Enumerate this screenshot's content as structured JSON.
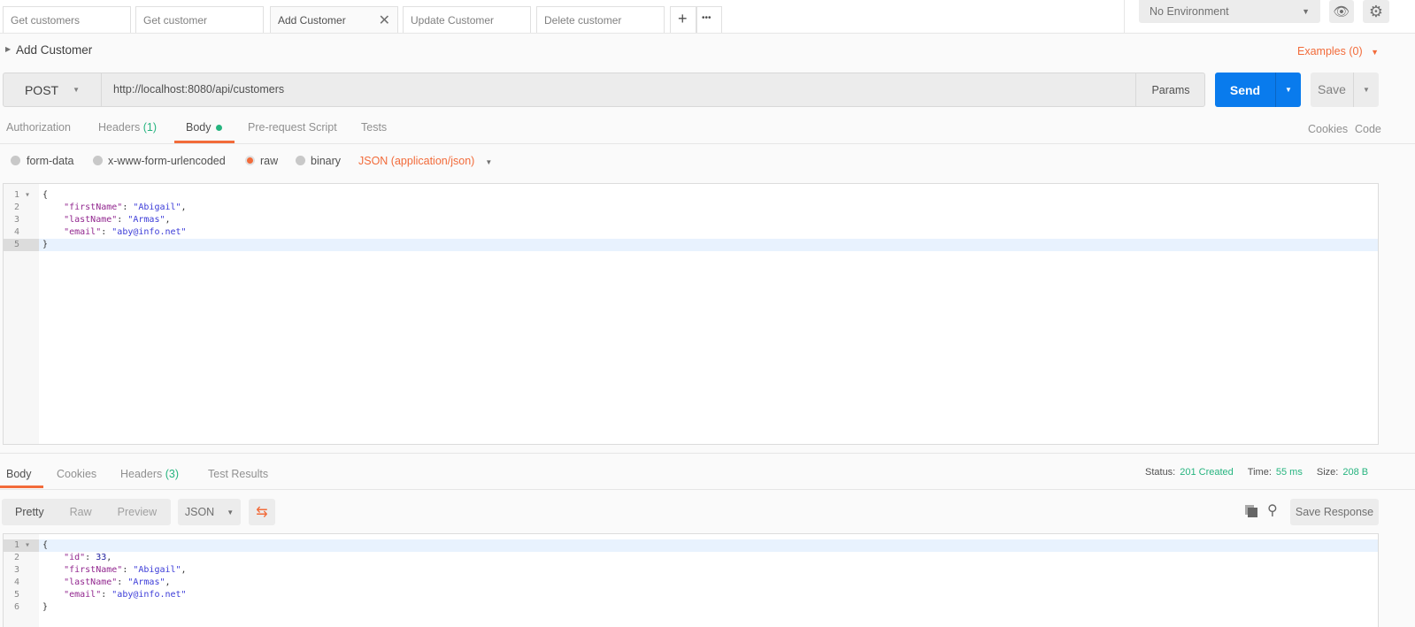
{
  "tabs": [
    {
      "label": "Get customers"
    },
    {
      "label": "Get customer"
    },
    {
      "label": "Add Customer",
      "active": true
    },
    {
      "label": "Update Customer"
    },
    {
      "label": "Delete customer"
    }
  ],
  "tab_add": "+",
  "tab_more": "•••",
  "environment": {
    "selected": "No Environment"
  },
  "request": {
    "title": "Add Customer",
    "examples": "Examples (0)",
    "method": "POST",
    "url": "http://localhost:8080/api/customers",
    "params": "Params",
    "send": "Send",
    "save": "Save"
  },
  "req_tabs": {
    "authorization": "Authorization",
    "headers": "Headers",
    "headers_count": "(1)",
    "body": "Body",
    "prerequest": "Pre-request Script",
    "tests": "Tests",
    "cookies": "Cookies",
    "code": "Code"
  },
  "body_options": {
    "form_data": "form-data",
    "urlencoded": "x-www-form-urlencoded",
    "raw": "raw",
    "binary": "binary",
    "content_type": "JSON (application/json)"
  },
  "request_body": [
    [
      {
        "t": "{",
        "c": "p"
      }
    ],
    [
      {
        "t": "    \"firstName\"",
        "c": "k"
      },
      {
        "t": ": ",
        "c": "p"
      },
      {
        "t": "\"Abigail\"",
        "c": "s"
      },
      {
        "t": ",",
        "c": "p"
      }
    ],
    [
      {
        "t": "    \"lastName\"",
        "c": "k"
      },
      {
        "t": ": ",
        "c": "p"
      },
      {
        "t": "\"Armas\"",
        "c": "s"
      },
      {
        "t": ",",
        "c": "p"
      }
    ],
    [
      {
        "t": "    \"email\"",
        "c": "k"
      },
      {
        "t": ": ",
        "c": "p"
      },
      {
        "t": "\"aby@info.net\"",
        "c": "s"
      }
    ],
    [
      {
        "t": "}",
        "c": "p"
      }
    ]
  ],
  "response": {
    "tabs": {
      "body": "Body",
      "cookies": "Cookies",
      "headers": "Headers",
      "headers_count": "(3)",
      "test_results": "Test Results"
    },
    "status_label": "Status:",
    "status": "201 Created",
    "time_label": "Time:",
    "time": "55 ms",
    "size_label": "Size:",
    "size": "208 B",
    "view": {
      "pretty": "Pretty",
      "raw": "Raw",
      "preview": "Preview",
      "format": "JSON"
    },
    "save_response": "Save Response",
    "body": [
      [
        {
          "t": "{",
          "c": "p"
        }
      ],
      [
        {
          "t": "    \"id\"",
          "c": "k"
        },
        {
          "t": ": ",
          "c": "p"
        },
        {
          "t": "33",
          "c": "n"
        },
        {
          "t": ",",
          "c": "p"
        }
      ],
      [
        {
          "t": "    \"firstName\"",
          "c": "k"
        },
        {
          "t": ": ",
          "c": "p"
        },
        {
          "t": "\"Abigail\"",
          "c": "s"
        },
        {
          "t": ",",
          "c": "p"
        }
      ],
      [
        {
          "t": "    \"lastName\"",
          "c": "k"
        },
        {
          "t": ": ",
          "c": "p"
        },
        {
          "t": "\"Armas\"",
          "c": "s"
        },
        {
          "t": ",",
          "c": "p"
        }
      ],
      [
        {
          "t": "    \"email\"",
          "c": "k"
        },
        {
          "t": ": ",
          "c": "p"
        },
        {
          "t": "\"aby@info.net\"",
          "c": "s"
        }
      ],
      [
        {
          "t": "}",
          "c": "p"
        }
      ]
    ]
  }
}
